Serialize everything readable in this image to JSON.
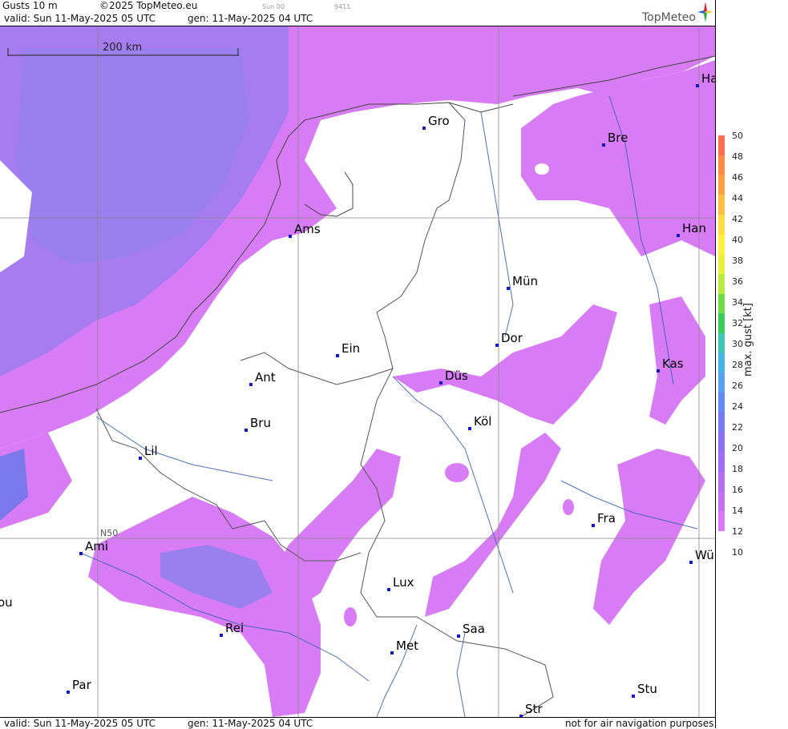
{
  "header": {
    "title": "Gusts 10 m",
    "copyright": "©2025 TopMeteo.eu",
    "small_run": "Sun 00",
    "small_id": "9411",
    "valid": "valid:  Sun  11-May-2025  05 UTC",
    "gen": "gen: 11-May-2025  04 UTC",
    "brand": "TopMeteo"
  },
  "footer": {
    "valid": "valid:  Sun  11-May-2025  05 UTC",
    "gen": "gen: 11-May-2025  04 UTC",
    "disclaimer": "not for air navigation purposes"
  },
  "map": {
    "scale_bar": "200 km",
    "latitude_label": "N50",
    "cities": [
      {
        "name": "Gro"
      },
      {
        "name": "Bre"
      },
      {
        "name": "Ha"
      },
      {
        "name": "Ams"
      },
      {
        "name": "Han"
      },
      {
        "name": "Mün"
      },
      {
        "name": "Ein"
      },
      {
        "name": "Dor"
      },
      {
        "name": "Kas"
      },
      {
        "name": "Ant"
      },
      {
        "name": "Düs"
      },
      {
        "name": "Bru"
      },
      {
        "name": "Köl"
      },
      {
        "name": "Lil"
      },
      {
        "name": "Fra"
      },
      {
        "name": "Ami"
      },
      {
        "name": "Wü"
      },
      {
        "name": "Lux"
      },
      {
        "name": "ou"
      },
      {
        "name": "Saa"
      },
      {
        "name": "Rei"
      },
      {
        "name": "Met"
      },
      {
        "name": "Par"
      },
      {
        "name": "Stu"
      },
      {
        "name": "Str"
      }
    ]
  },
  "legend": {
    "axis_label": "max. gust [kt]",
    "ticks": [
      "50",
      "48",
      "46",
      "44",
      "42",
      "40",
      "38",
      "36",
      "34",
      "32",
      "30",
      "28",
      "26",
      "24",
      "22",
      "20",
      "18",
      "16",
      "14",
      "12",
      "10"
    ],
    "colors": [
      "#ff6e50",
      "#ff8a46",
      "#ffa040",
      "#ffbe40",
      "#ffdc40",
      "#fff040",
      "#e8f040",
      "#b8ec40",
      "#70dc48",
      "#3ccc5a",
      "#3cc8b4",
      "#46b4e6",
      "#5aa0f0",
      "#648cf0",
      "#7878f0",
      "#8c6ef0",
      "#a06ef0",
      "#b46ef0",
      "#c870f0",
      "#dc78f8"
    ]
  }
}
